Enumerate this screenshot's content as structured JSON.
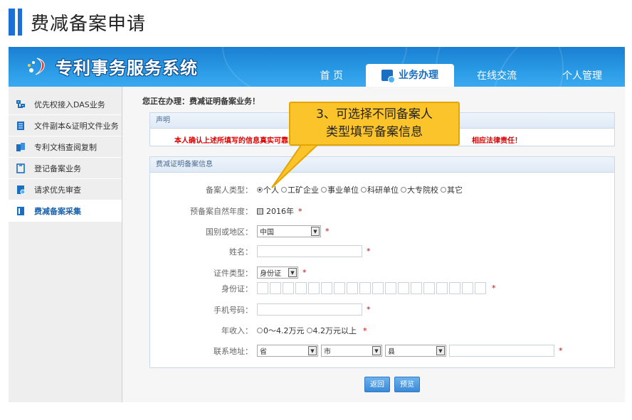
{
  "slide": {
    "title": "费减备案申请"
  },
  "app": {
    "logo_text": "专利事务服务系统",
    "nav": [
      {
        "label": "首 页"
      },
      {
        "label": "业务办理"
      },
      {
        "label": "在线交流"
      },
      {
        "label": "个人管理"
      }
    ]
  },
  "sidebar": {
    "items": [
      {
        "label": "优先权接入DAS业务",
        "icon": "branch-icon"
      },
      {
        "label": "文件副本&证明文件业务",
        "icon": "document-icon"
      },
      {
        "label": "专利文档查阅复制",
        "icon": "copy-icon"
      },
      {
        "label": "登记备案业务",
        "icon": "register-icon"
      },
      {
        "label": "请求优先审查",
        "icon": "clipboard-icon"
      },
      {
        "label": "费减备案采集",
        "icon": "book-icon"
      }
    ]
  },
  "main": {
    "breadcrumb": "您正在办理：费减证明备案业务！",
    "declaration": {
      "heading": "声明",
      "text_start": "本人确认上述所填写的信息真实可靠，",
      "text_end": "相应法律责任！"
    },
    "form": {
      "heading": "费减证明备案信息",
      "applicant_type_label": "备案人类型：",
      "applicant_types": [
        "个人",
        "工矿企业",
        "事业单位",
        "科研单位",
        "大专院校",
        "其它"
      ],
      "year_label": "预备案自然年度：",
      "year_value": "2016年",
      "region_label": "国别或地区：",
      "region_value": "中国",
      "name_label": "姓名：",
      "id_type_label": "证件类型：",
      "id_type_value": "身份证",
      "id_label": "身份证：",
      "phone_label": "手机号码：",
      "income_label": "年收入：",
      "income_options": [
        "0～4.2万元",
        "4.2万元以上"
      ],
      "address_label": "联系地址：",
      "province": "省",
      "city": "市",
      "county": "县",
      "required_mark": "*"
    },
    "buttons": {
      "back": "返回",
      "preview": "预览"
    }
  },
  "callout": {
    "line1": "3、可选择不同备案人",
    "line2": "类型填写备案信息"
  },
  "colors": {
    "accent": "#1b6fd6",
    "banner": "#2a9be6",
    "callout": "#fcc42b",
    "required": "#e00000"
  }
}
